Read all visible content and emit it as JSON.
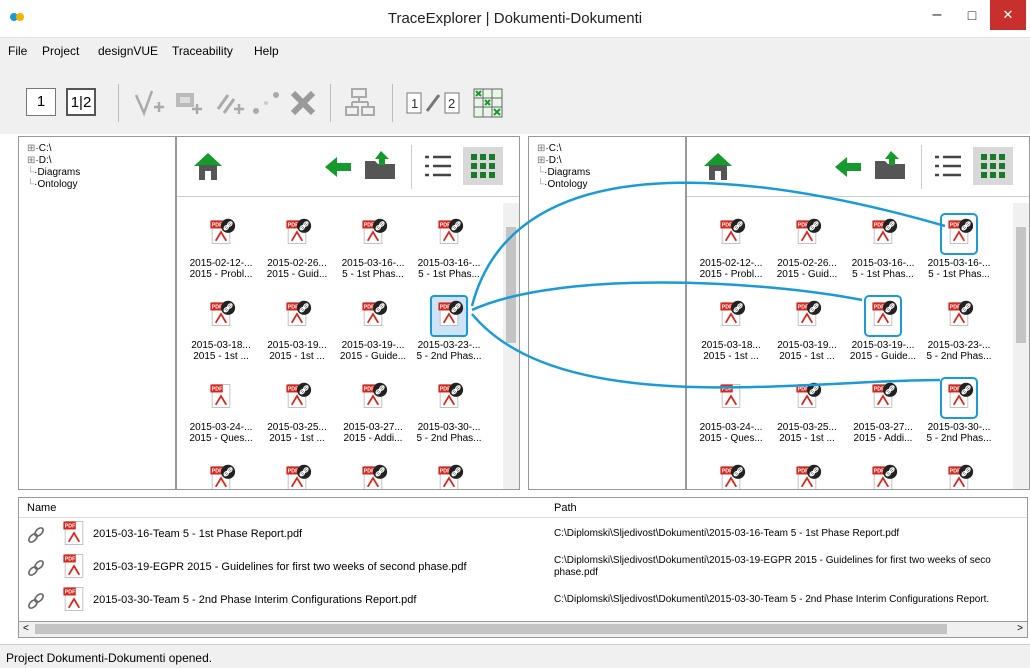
{
  "window": {
    "title": "TraceExplorer | Dokumenti-Dokumenti",
    "minimize": "–",
    "maximize": "□",
    "close": "✕"
  },
  "menu": [
    "File",
    "Project",
    "designVUE",
    "Traceability",
    "Help"
  ],
  "toolbar": {
    "view1": "1",
    "view12": "1|2"
  },
  "tree": [
    "C:\\",
    "D:\\",
    "Diagrams",
    "Ontology"
  ],
  "left_files": [
    {
      "l1": "2015-02-12-...",
      "l2": "2015 - Probl...",
      "linked": true
    },
    {
      "l1": "2015-02-26...",
      "l2": "2015 - Guid...",
      "linked": true
    },
    {
      "l1": "2015-03-16-...",
      "l2": "5 - 1st Phas...",
      "linked": true
    },
    {
      "l1": "2015-03-16-...",
      "l2": "5 - 1st Phas...",
      "linked": true
    },
    {
      "l1": "2015-03-18...",
      "l2": "2015 - 1st ...",
      "linked": true
    },
    {
      "l1": "2015-03-19...",
      "l2": "2015 - 1st ...",
      "linked": true
    },
    {
      "l1": "2015-03-19-...",
      "l2": "2015 - Guide...",
      "linked": true
    },
    {
      "l1": "2015-03-23-...",
      "l2": "5 - 2nd Phas...",
      "linked": true,
      "selected": true
    },
    {
      "l1": "2015-03-24-...",
      "l2": "2015 - Ques...",
      "linked": false
    },
    {
      "l1": "2015-03-25...",
      "l2": "2015 - 1st ...",
      "linked": true
    },
    {
      "l1": "2015-03-27...",
      "l2": "2015 - Addi...",
      "linked": true
    },
    {
      "l1": "2015-03-30-...",
      "l2": "5 - 2nd Phas...",
      "linked": true
    }
  ],
  "right_files": [
    {
      "l1": "2015-02-12-...",
      "l2": "2015 - Probl...",
      "linked": true
    },
    {
      "l1": "2015-02-26...",
      "l2": "2015 - Guid...",
      "linked": true
    },
    {
      "l1": "2015-03-16-...",
      "l2": "5 - 1st Phas...",
      "linked": true
    },
    {
      "l1": "2015-03-16-...",
      "l2": "5 - 1st Phas...",
      "linked": true,
      "highlight": true
    },
    {
      "l1": "2015-03-18...",
      "l2": "2015 - 1st ...",
      "linked": true
    },
    {
      "l1": "2015-03-19...",
      "l2": "2015 - 1st ...",
      "linked": true
    },
    {
      "l1": "2015-03-19-...",
      "l2": "2015 - Guide...",
      "linked": true,
      "highlight": true
    },
    {
      "l1": "2015-03-23-...",
      "l2": "5 - 2nd Phas...",
      "linked": true
    },
    {
      "l1": "2015-03-24-...",
      "l2": "2015 - Ques...",
      "linked": false
    },
    {
      "l1": "2015-03-25...",
      "l2": "2015 - 1st ...",
      "linked": true
    },
    {
      "l1": "2015-03-27...",
      "l2": "2015 - Addi...",
      "linked": true
    },
    {
      "l1": "2015-03-30-...",
      "l2": "5 - 2nd Phas...",
      "linked": true,
      "highlight": true
    }
  ],
  "list": {
    "headers": {
      "name": "Name",
      "path": "Path"
    },
    "rows": [
      {
        "name": "2015-03-16-Team 5 - 1st Phase Report.pdf",
        "path": "C:\\Diplomski\\Sljedivost\\Dokumenti\\2015-03-16-Team 5 - 1st Phase Report.pdf",
        "path2": ""
      },
      {
        "name": "2015-03-19-EGPR 2015 - Guidelines for first two weeks of second phase.pdf",
        "path": "C:\\Diplomski\\Sljedivost\\Dokumenti\\2015-03-19-EGPR 2015 - Guidelines for first two weeks of seco",
        "path2": "phase.pdf"
      },
      {
        "name": "2015-03-30-Team 5 - 2nd Phase Interim Configurations Report.pdf",
        "path": "C:\\Diplomski\\Sljedivost\\Dokumenti\\2015-03-30-Team 5 - 2nd Phase Interim Configurations Report.",
        "path2": ""
      }
    ]
  },
  "status": "Project Dokumenti-Dokumenti opened.",
  "colors": {
    "accent": "#1a9bd7",
    "pdf_red": "#d9261c",
    "green": "#159a2c"
  }
}
